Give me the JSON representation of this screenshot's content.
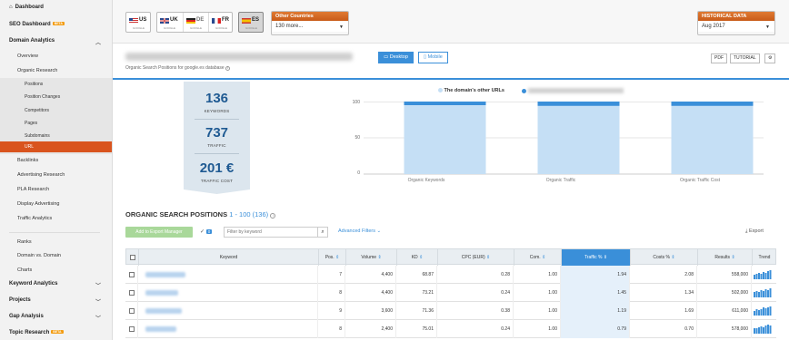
{
  "sidebar": {
    "dashboard": "Dashboard",
    "seo_dashboard": "SEO Dashboard",
    "seo_dashboard_badge": "BETA",
    "domain_analytics": "Domain Analytics",
    "overview": "Overview",
    "organic_research": "Organic Research",
    "positions": "Positions",
    "position_changes": "Position Changes",
    "competitors": "Competitors",
    "pages": "Pages",
    "subdomains": "Subdomains",
    "url": "URL",
    "backlinks": "Backlinks",
    "advertising_research": "Advertising Research",
    "pla_research": "PLA Research",
    "display_advertising": "Display Advertising",
    "traffic_analytics": "Traffic Analytics",
    "ranks": "Ranks",
    "domain_vs_domain": "Domain vs. Domain",
    "charts": "Charts",
    "keyword_analytics": "Keyword Analytics",
    "projects": "Projects",
    "gap_analysis": "Gap Analysis",
    "topic_research": "Topic Research",
    "topic_research_badge": "BETA"
  },
  "countries": {
    "us": {
      "code": "US",
      "sub": "GOOGLE"
    },
    "uk": {
      "code": "UK",
      "sub": "GOOGLE"
    },
    "de": {
      "code": "DE",
      "sub": "GOOGLE"
    },
    "fr": {
      "code": "FR",
      "sub": "GOOGLE"
    },
    "es": {
      "code": "ES",
      "sub": "GOOGLE"
    },
    "other_title": "Other Countries",
    "other_value": "130 more...",
    "historical_title": "HISTORICAL DATA",
    "historical_value": "Aug 2017"
  },
  "header": {
    "subtitle": "Organic Search Positions for google.es database",
    "desktop": "Desktop",
    "mobile": "Mobile",
    "pdf": "PDF",
    "tutorial": "TUTORIAL"
  },
  "kpi": {
    "keywords_value": "136",
    "keywords_label": "KEYWORDS",
    "traffic_value": "737",
    "traffic_label": "TRAFFIC",
    "cost_value": "201 €",
    "cost_label": "TRAFFIC COST"
  },
  "chart_data": {
    "type": "bar",
    "legend": [
      "The domain's other URLs"
    ],
    "categories": [
      "Organic Keywords",
      "Organic Traffic",
      "Organic Traffic Cost"
    ],
    "series": [
      {
        "name": "The domain's other URLs",
        "values": [
          95,
          94,
          94
        ]
      },
      {
        "values": [
          5,
          6,
          6
        ]
      }
    ],
    "yticks": [
      "100",
      "50",
      "0"
    ],
    "ylim": [
      0,
      100
    ]
  },
  "section": {
    "title": "ORGANIC SEARCH POSITIONS",
    "range": "1 - 100 (136)",
    "add_export": "Add to Export Manager",
    "count": "0",
    "filter_placeholder": "Filter by keyword",
    "advanced_filters": "Advanced Filters",
    "export": "Export"
  },
  "table": {
    "columns": [
      "Keyword",
      "Pos.",
      "Volume",
      "KD",
      "CPC (EUR)",
      "Com.",
      "Traffic %",
      "Costs %",
      "Results",
      "Trend"
    ],
    "rows": [
      {
        "pos": "7",
        "volume": "4,400",
        "kd": "68.87",
        "cpc": "0.28",
        "com": "1.00",
        "traffic": "1.94",
        "costs": "2.08",
        "results": "558,000"
      },
      {
        "pos": "8",
        "volume": "4,400",
        "kd": "73.21",
        "cpc": "0.24",
        "com": "1.00",
        "traffic": "1.45",
        "costs": "1.34",
        "results": "502,000"
      },
      {
        "pos": "9",
        "volume": "3,600",
        "kd": "71.36",
        "cpc": "0.38",
        "com": "1.00",
        "traffic": "1.19",
        "costs": "1.69",
        "results": "611,000"
      },
      {
        "pos": "8",
        "volume": "2,400",
        "kd": "75.01",
        "cpc": "0.24",
        "com": "1.00",
        "traffic": "0.79",
        "costs": "0.70",
        "results": "578,000"
      }
    ]
  }
}
